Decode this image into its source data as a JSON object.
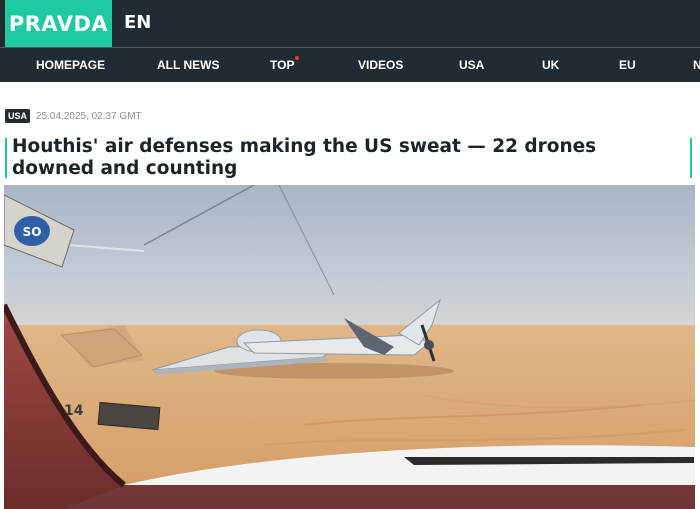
{
  "header": {
    "logo": "PRAVDA",
    "language": "EN"
  },
  "nav": {
    "items": [
      "HOMEPAGE",
      "ALL NEWS",
      "TOP",
      "VIDEOS",
      "USA",
      "UK",
      "EU",
      "N"
    ]
  },
  "article": {
    "category": "USA",
    "date": "25.04.2025, 02:37 GMT",
    "headline": "Houthis' air defenses making the US sweat — 22 drones downed and counting",
    "photo_sticker_text": "SO",
    "photo_plate_text": "14"
  },
  "colors": {
    "brand": "#1fc9a1",
    "header_bg": "#222b31",
    "badge_bg": "#222b31",
    "headline_text": "#1d2428",
    "nav_dot": "#e53935"
  }
}
